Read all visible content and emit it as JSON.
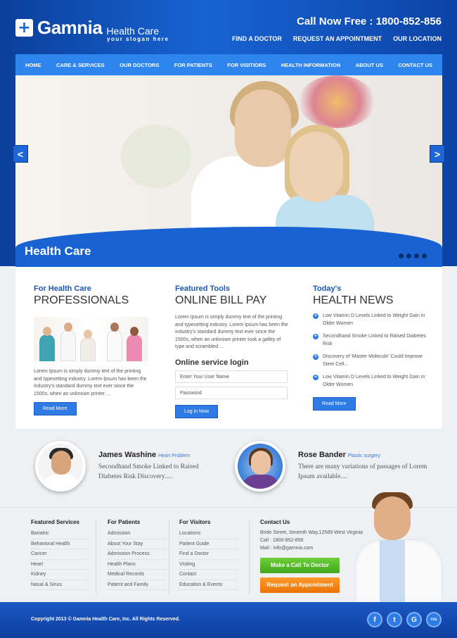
{
  "brand": {
    "name": "Gamnia",
    "sub": "Health Care",
    "slogan": "your slogan here"
  },
  "header": {
    "call": "Call Now Free : 1800-852-856",
    "links": [
      "FIND A DOCTOR",
      "REQUEST AN APPOINTMENT",
      "OUR LOCATION"
    ]
  },
  "nav": [
    "HOME",
    "CARE & SERVICES",
    "OUR DOCTORS",
    "FOR PATIENTS",
    "FOR VISITIORS",
    "HEALTH INFORMATION",
    "ABOUT US",
    "CONTACT US"
  ],
  "slider": {
    "caption": "Health Care",
    "prev": "<",
    "next": ">"
  },
  "col1": {
    "sub": "For Health Care",
    "title": "PROFESSIONALS",
    "text": "Lorem Ipsum is simply dummy text of the printing and typesetting industry. Lorem Ipsum has been the industry's standard dummy text ever since the 1500s, when an unknown printer ...",
    "button": "Read More"
  },
  "col2": {
    "sub": "Featured Tools",
    "title": "ONLINE BILL PAY",
    "text": "Lorem Ipsum is simply dummy text of the printing and typesetting industry. Lorem Ipsum has been the industry's standard dummy text ever since the 1500s, when an unknown printer took a galley of type and scrambled ...",
    "login_title": "Online service login",
    "username_placeholder": "Enter Your User Name",
    "password_placeholder": "Password",
    "button": "Log in Now"
  },
  "col3": {
    "sub": "Today's",
    "title": "HEALTH NEWS",
    "items": [
      "Low Vitamin D Levels Linked to Weight Gain in Older Women",
      "Secondhand Smoke Linked to Raised Diabetes Risk",
      "Discovery of 'Master Molecule' Could Improve Stem Cell...",
      "Low Vitamin D Levels Linked to Weight Gain in Older Women"
    ],
    "button": "Read More"
  },
  "testimonials": [
    {
      "name": "James Washine",
      "role": "Heart Problem",
      "text": "Secondhand Smoke Linked to Raised Diabetes Risk Discovery....."
    },
    {
      "name": "Rose Bander",
      "role": "Plastic surgery",
      "text": "There are many variations of passages of Lorem Ipsum available...."
    }
  ],
  "footer": {
    "featured": {
      "title": "Featured Services",
      "links": [
        "Bariatric",
        "Behavioral Health",
        "Cancer",
        "Heart",
        "Kidney",
        "Nasal & Sinus"
      ]
    },
    "patients": {
      "title": "For Patients",
      "links": [
        "Admission",
        "About Your Stay",
        "Admission Process",
        "Health Plans",
        "Medical Records",
        "Patient and Family"
      ]
    },
    "visitors": {
      "title": "For Visitors",
      "links": [
        "Locations",
        "Patient Guide",
        "Find a Doctor",
        "Visiting",
        "Contact",
        "Education & Events"
      ]
    },
    "contact": {
      "title": "Contact Us",
      "address": "Bride Street, Seventh Way,12589 West Virginia",
      "phone": "Call : 1800-852-856",
      "mail": "Mail : info@gamnia.com",
      "call_button": "Make a Call To Doctor",
      "appointment_button": "Request an Appointment"
    }
  },
  "bottom": {
    "copyright": "Copyright 2013 © Gamnia Health Care, Inc. All Rights Reserved.",
    "social": [
      "f",
      "t",
      "G",
      "rss"
    ]
  },
  "colors": {
    "brand_blue": "#1763d3",
    "nav_blue": "#2f85ee",
    "green": "#44a71c",
    "orange": "#ea7305"
  }
}
